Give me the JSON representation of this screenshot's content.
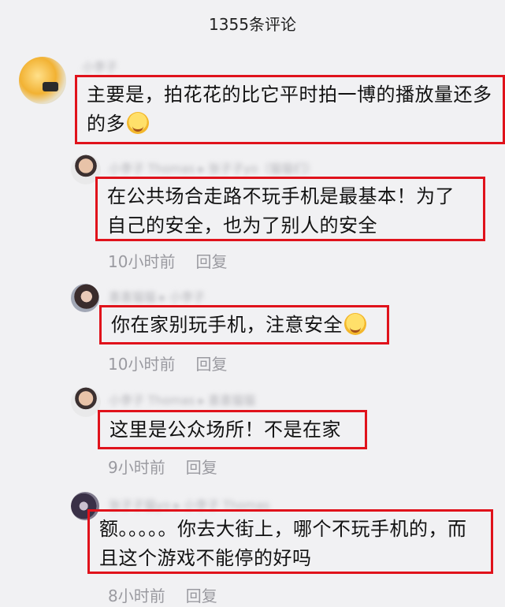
{
  "header": {
    "title": "1355条评论"
  },
  "comments": [
    {
      "name": "小李子",
      "text": "主要是，拍花花的比它平时拍一博的播放量还多的多",
      "emoji": "laughing-tears-emoji"
    },
    {
      "name": "小李子 Thomas ▸ 张子子yo（猫猫们）",
      "text": "在公共场合走路不玩手机是最基本！为了自己的安全，也为了别人的安全",
      "time": "10小时前",
      "reply": "回复"
    },
    {
      "name": "喜喜猫猫 ▸ 小李子",
      "text": "你在家别玩手机，注意安全",
      "emoji": "smiling-emoji",
      "time": "10小时前",
      "reply": "回复"
    },
    {
      "name": "小李子 Thomas ▸ 喜喜猫猫",
      "text": "这里是公众场所！不是在家",
      "time": "9小时前",
      "reply": "回复"
    },
    {
      "name": "张子子猫yo ▸ 小李子 Thomas",
      "text": "额。。。。。你去大街上，哪个不玩手机的，而且这个游戏不能停的好吗",
      "time": "8小时前",
      "reply": "回复"
    }
  ]
}
